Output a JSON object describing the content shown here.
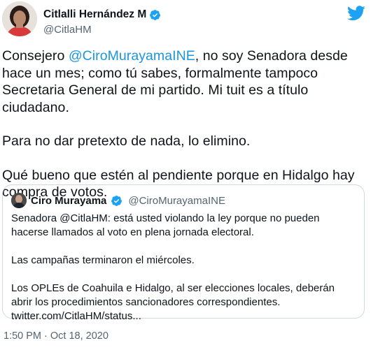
{
  "author": {
    "name": "Citlalli Hernández M",
    "handle": "@CitlaHM",
    "verified": true
  },
  "tweet": {
    "paragraph1": {
      "before": "Consejero ",
      "mention": "@CiroMurayamaINE",
      "after": ", no soy Senadora desde hace un mes; como tú sabes, formalmente tampoco Secretaria General de mi partido. Mi tuit es a título ciudadano."
    },
    "paragraph2": "Para no dar pretexto de nada, lo elimino.",
    "paragraph3": "Qué bueno que estén al pendiente porque en Hidalgo hay compra de votos."
  },
  "quoted": {
    "name": "Ciro Murayama",
    "handle": "@CiroMurayamaINE",
    "verified": true,
    "paragraph1": "Senadora @CitlaHM: está usted violando la ley porque no pueden hacerse llamados al voto en plena jornada electoral.",
    "paragraph2": "Las campañas terminaron el miércoles.",
    "paragraph3": "Los OPLEs de Coahuila e Hidalgo, al ser elecciones locales, deberán abrir los procedimientos sancionadores correspondientes.",
    "link": "twitter.com/CitlaHM/status..."
  },
  "timestamp": "1:50 PM · Oct 18, 2020",
  "icons": {
    "brand": "twitter-bird-icon",
    "verified": "verified-badge-icon"
  },
  "colors": {
    "brand": "#1da1f2",
    "mention": "#1b95e0",
    "text": "#0f1419",
    "muted": "#536471",
    "border": "#cfd9de"
  }
}
